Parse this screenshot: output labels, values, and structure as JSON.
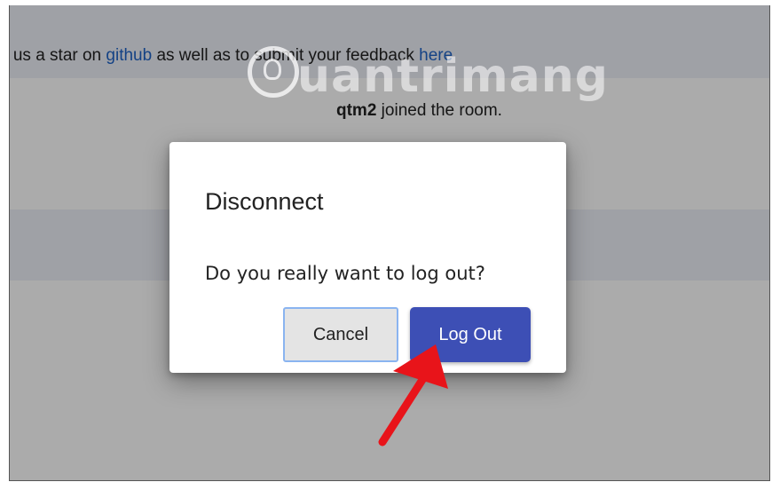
{
  "banner": {
    "prefix": "e us a star on ",
    "github_link": "github",
    "middle": " as well as to submit your feedback ",
    "here_link": "here"
  },
  "chat": {
    "username": "qtm2",
    "joined_text": " joined the room."
  },
  "watermark": {
    "text": "uantrimang"
  },
  "dialog": {
    "title": "Disconnect",
    "body": "Do you really want to log out?",
    "cancel_label": "Cancel",
    "logout_label": "Log Out"
  },
  "colors": {
    "accent": "#3d4fb5",
    "link": "#1e63c6",
    "annotation_arrow": "#e8141a"
  }
}
